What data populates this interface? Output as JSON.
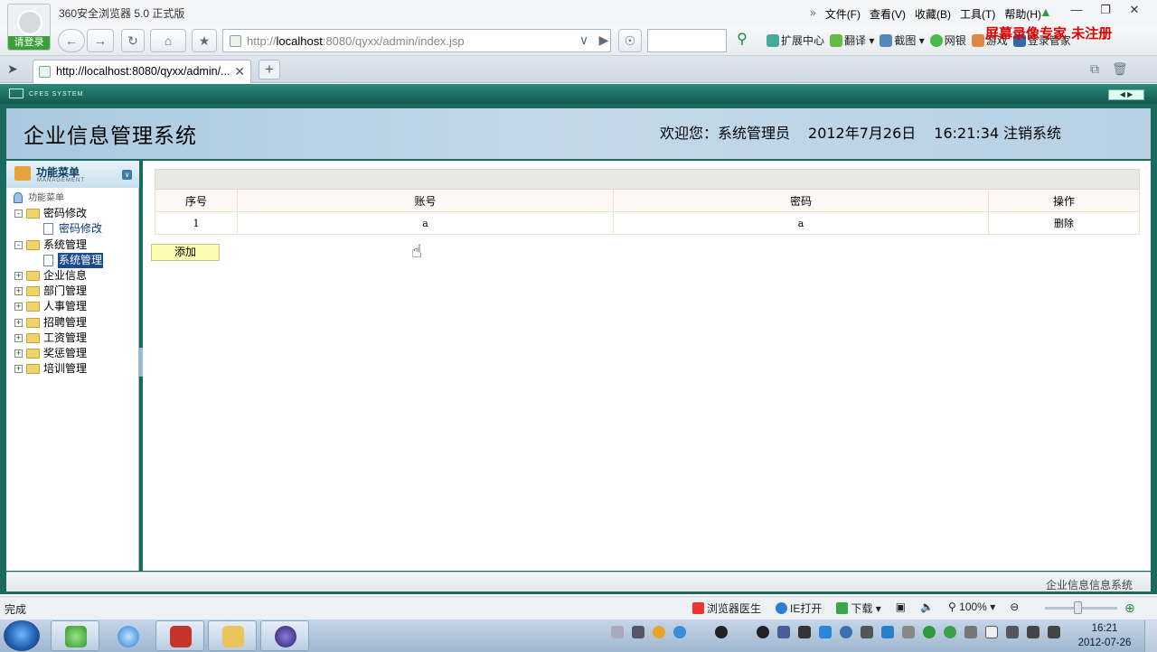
{
  "browser": {
    "app_title": "360安全浏览器 5.0 正式版",
    "login_label": "请登录",
    "menu": [
      "文件(F)",
      "查看(V)",
      "收藏(B)",
      "工具(T)",
      "帮助(H)"
    ],
    "menu_more": "»",
    "url_prefix": "http://",
    "url_host": "localhost",
    "url_rest": ":8080/qyxx/admin/index.jsp",
    "tools": [
      "扩展中心",
      "翻译",
      "截图",
      "网银",
      "游戏",
      "登录管家"
    ],
    "watermark": "屏幕录像专家 未注册",
    "tab_title": "http://localhost:8080/qyxx/admin/...",
    "status_text": "完成",
    "status_tools": [
      "浏览器医生",
      "IE打开",
      "下载"
    ],
    "zoom": "100%",
    "zoom_level": 0.45
  },
  "app": {
    "frame_label": "CFES SYSTEM",
    "title": "企业信息管理系统",
    "welcome": "欢迎您：系统管理员",
    "date": "2012年7月26日",
    "time": "16:21:34",
    "logout": "注销系统",
    "footer": "企业信息信息系统",
    "menu_title": "功能菜单",
    "menu_subtitle": "MANAGEMENT",
    "tree_root": "功能菜单",
    "tree": [
      {
        "label": "密码修改",
        "expanded": true,
        "children": [
          "密码修改"
        ]
      },
      {
        "label": "系统管理",
        "expanded": true,
        "children": [
          "系统管理"
        ]
      },
      {
        "label": "企业信息",
        "expanded": false
      },
      {
        "label": "部门管理",
        "expanded": false
      },
      {
        "label": "人事管理",
        "expanded": false
      },
      {
        "label": "招聘管理",
        "expanded": false
      },
      {
        "label": "工资管理",
        "expanded": false
      },
      {
        "label": "奖惩管理",
        "expanded": false
      },
      {
        "label": "培训管理",
        "expanded": false
      }
    ],
    "table": {
      "headers": [
        "序号",
        "账号",
        "密码",
        "操作"
      ],
      "rows": [
        [
          "1",
          "a",
          "a",
          "删除"
        ]
      ]
    },
    "add_button": "添加"
  },
  "taskbar": {
    "clock_time": "16:21",
    "clock_date": "2012-07-26"
  },
  "colors": {
    "frame": "#1a6a60",
    "header": "#b7d0e3",
    "add_button": "#fdfcb0",
    "watermark": "#e00000"
  }
}
